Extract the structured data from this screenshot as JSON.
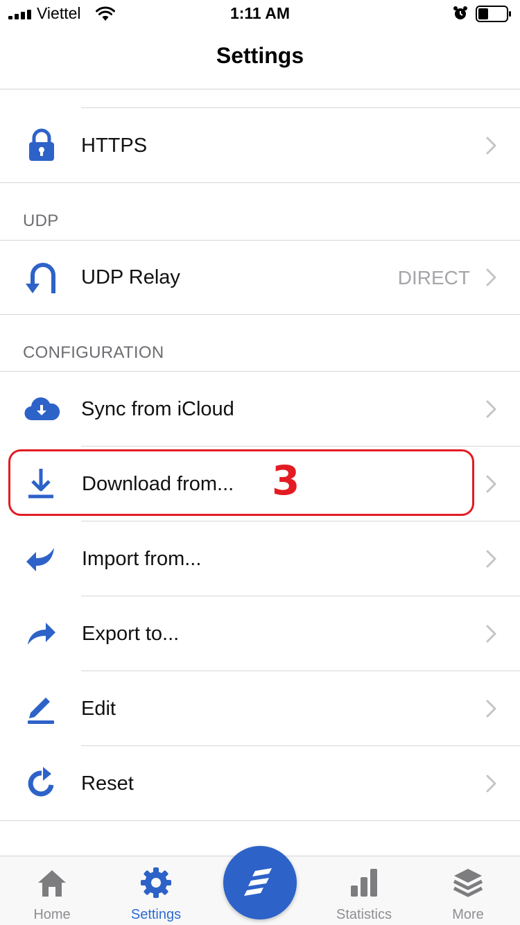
{
  "status_bar": {
    "carrier": "Viettel",
    "time": "1:11 AM"
  },
  "nav": {
    "title": "Settings"
  },
  "rows": {
    "https": {
      "label": "HTTPS",
      "icon": "lock-icon"
    },
    "udp_relay": {
      "label": "UDP Relay",
      "value": "DIRECT",
      "icon": "u-turn-icon"
    },
    "sync_icloud": {
      "label": "Sync from iCloud",
      "icon": "cloud-download-icon"
    },
    "download_from": {
      "label": "Download from...",
      "icon": "download-icon"
    },
    "import_from": {
      "label": "Import from...",
      "icon": "reply-arrow-icon"
    },
    "export_to": {
      "label": "Export to...",
      "icon": "share-arrow-icon"
    },
    "edit": {
      "label": "Edit",
      "icon": "pencil-icon"
    },
    "reset": {
      "label": "Reset",
      "icon": "reset-icon"
    }
  },
  "sections": {
    "udp": "UDP",
    "configuration": "CONFIGURATION"
  },
  "annotation": {
    "step": "3",
    "color": "#e31b23"
  },
  "tabs": [
    {
      "label": "Home",
      "icon": "home-icon"
    },
    {
      "label": "Settings",
      "icon": "gear-icon",
      "active": true
    },
    {
      "label": "",
      "icon": "surge-logo-icon"
    },
    {
      "label": "Statistics",
      "icon": "bar-chart-icon"
    },
    {
      "label": "More",
      "icon": "layers-icon"
    }
  ],
  "colors": {
    "accent": "#2d62c8",
    "secondary_text": "#a5a5aa",
    "section_header": "#6d6d72"
  }
}
